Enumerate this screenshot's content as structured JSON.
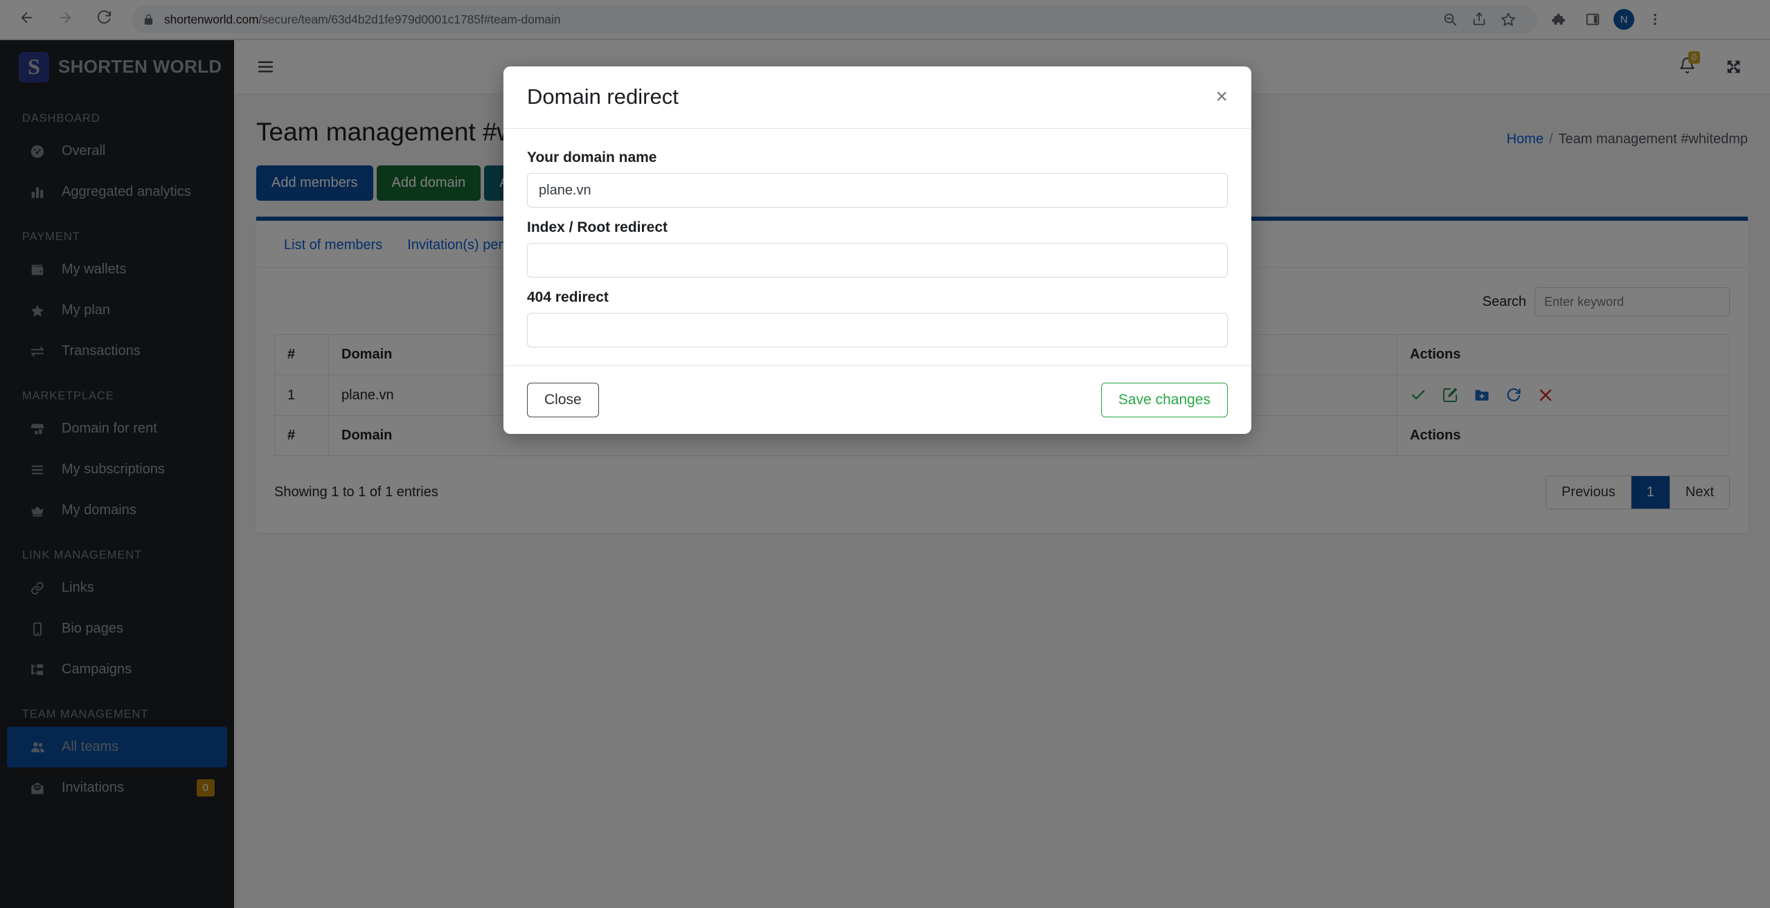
{
  "browser": {
    "url_domain": "shortenworld.com",
    "url_path": "/secure/team/63d4b2d1fe979d0001c1785f#team-domain",
    "back_icon": "back-arrow-icon",
    "forward_icon": "forward-arrow-icon",
    "reload_icon": "reload-icon",
    "lock_icon": "lock-icon",
    "zoom_icon": "zoom-out-icon",
    "share_icon": "share-icon",
    "bookmark_icon": "star-icon",
    "extensions_icon": "puzzle-icon",
    "sidepanel_icon": "side-panel-icon",
    "profile_initial": "N",
    "menu_icon": "three-dot-menu-icon"
  },
  "sidebar": {
    "brand_mark": "S",
    "brand_text": "SHORTEN WORLD",
    "sections": [
      {
        "title": "DASHBOARD",
        "items": [
          {
            "label": "Overall",
            "icon": "gauge-icon",
            "active": false
          },
          {
            "label": "Aggregated analytics",
            "icon": "bar-chart-icon",
            "active": false
          }
        ]
      },
      {
        "title": "PAYMENT",
        "items": [
          {
            "label": "My wallets",
            "icon": "wallet-icon",
            "active": false
          },
          {
            "label": "My plan",
            "icon": "star-icon",
            "active": false
          },
          {
            "label": "Transactions",
            "icon": "exchange-arrows-icon",
            "active": false
          }
        ]
      },
      {
        "title": "MARKETPLACE",
        "items": [
          {
            "label": "Domain for rent",
            "icon": "store-icon",
            "active": false
          },
          {
            "label": "My subscriptions",
            "icon": "list-icon",
            "active": false
          },
          {
            "label": "My domains",
            "icon": "crown-icon",
            "active": false
          }
        ]
      },
      {
        "title": "LINK MANAGEMENT",
        "items": [
          {
            "label": "Links",
            "icon": "link-icon",
            "active": false
          },
          {
            "label": "Bio pages",
            "icon": "mobile-icon",
            "active": false
          },
          {
            "label": "Campaigns",
            "icon": "sitemap-icon",
            "active": false
          }
        ]
      },
      {
        "title": "TEAM MANAGEMENT",
        "items": [
          {
            "label": "All teams",
            "icon": "users-icon",
            "active": true
          },
          {
            "label": "Invitations",
            "icon": "envelope-open-icon",
            "active": false,
            "badge": "0"
          }
        ]
      }
    ]
  },
  "topbar": {
    "hamburger_icon": "hamburger-menu-icon",
    "bell_icon": "bell-icon",
    "bell_badge": "0",
    "expand_icon": "expand-arrows-icon"
  },
  "page": {
    "title": "Team management #whitedmp",
    "breadcrumb_home": "Home",
    "breadcrumb_sep": "/",
    "breadcrumb_current": "Team management #whitedmp",
    "buttons": [
      {
        "label": "Add members",
        "style": "primary"
      },
      {
        "label": "Add domain",
        "style": "success"
      },
      {
        "label": "Add",
        "style": "info"
      }
    ]
  },
  "card": {
    "tabs": [
      {
        "label": "List of members"
      },
      {
        "label": "Invitation(s) pending"
      }
    ]
  },
  "search": {
    "label": "Search",
    "placeholder": "Enter keyword",
    "value": ""
  },
  "table": {
    "headers": [
      "#",
      "Domain",
      "Actions"
    ],
    "footer_headers": [
      "#",
      "Domain",
      "Actions"
    ],
    "rows": [
      {
        "num": "1",
        "domain": "plane.vn",
        "actions": [
          {
            "icon": "check-icon",
            "color": "#2e9e4f"
          },
          {
            "icon": "edit-pencil-icon",
            "color": "#2e8b57"
          },
          {
            "icon": "folder-plus-icon",
            "color": "#1665c0"
          },
          {
            "icon": "refresh-icon",
            "color": "#1665c0"
          },
          {
            "icon": "close-x-icon",
            "color": "#c62828"
          }
        ]
      }
    ],
    "entries_info": "Showing 1 to 1 of 1 entries",
    "pagination": {
      "previous": "Previous",
      "pages": [
        "1"
      ],
      "next": "Next",
      "current": "1"
    }
  },
  "modal": {
    "title": "Domain redirect",
    "close_icon": "close-x-icon",
    "fields": [
      {
        "label": "Your domain name",
        "value": "plane.vn",
        "placeholder": ""
      },
      {
        "label": "Index / Root redirect",
        "value": "",
        "placeholder": ""
      },
      {
        "label": "404 redirect",
        "value": "",
        "placeholder": ""
      }
    ],
    "close_label": "Close",
    "save_label": "Save changes"
  },
  "colors": {
    "brand_blue": "#0b4f9e",
    "success_green": "#176b32",
    "info_teal": "#11646e",
    "link_blue": "#0b5ed7",
    "badge_gold": "#b8860b"
  }
}
